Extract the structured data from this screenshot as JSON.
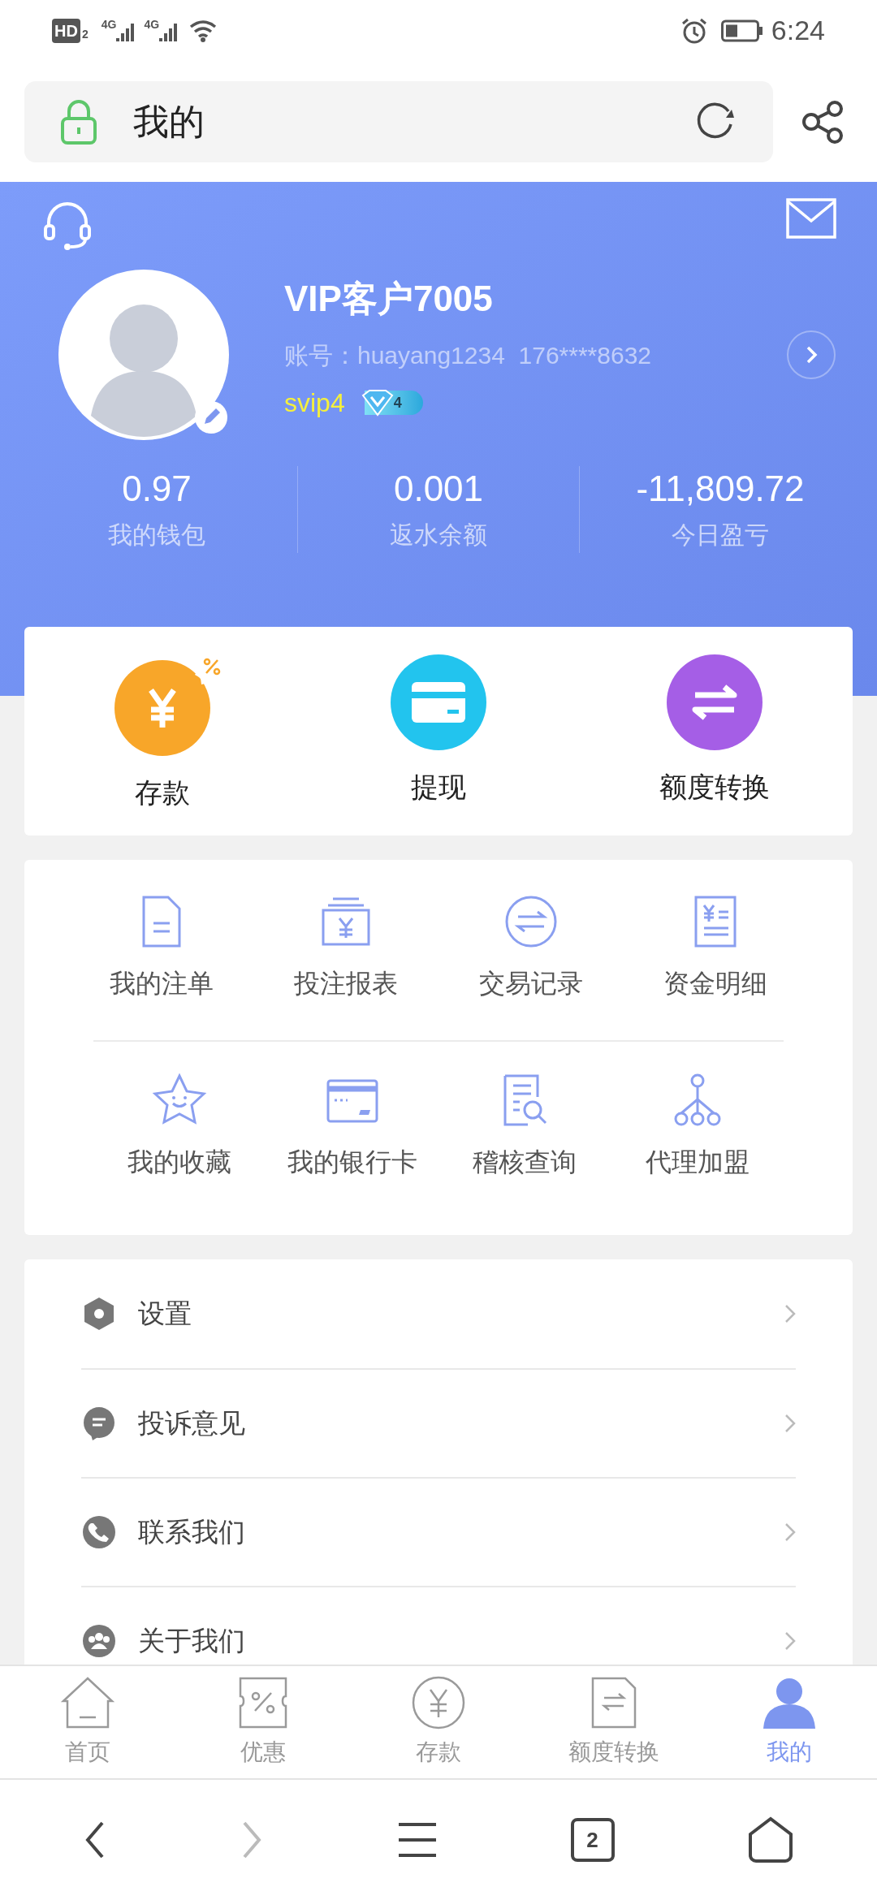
{
  "status_bar": {
    "hd": "HD",
    "sim": "2",
    "network_1": "4G",
    "network_2": "4G",
    "time": "6:24"
  },
  "address_bar": {
    "title": "我的"
  },
  "profile": {
    "name": "VIP客户7005",
    "account": "账号：huayang1234  176****8632",
    "vip_level": "svip4",
    "badge_number": "4"
  },
  "stats": [
    {
      "value": "0.97",
      "label": "我的钱包"
    },
    {
      "value": "0.001",
      "label": "返水余额"
    },
    {
      "value": "-11,809.72",
      "label": "今日盈亏"
    }
  ],
  "actions": [
    {
      "kind": "deposit",
      "label": "存款"
    },
    {
      "kind": "withdraw",
      "label": "提现"
    },
    {
      "kind": "transfer",
      "label": "额度转换"
    }
  ],
  "shortcuts": [
    {
      "kind": "doc",
      "label": "我的注单"
    },
    {
      "kind": "report",
      "label": "投注报表"
    },
    {
      "kind": "exchange",
      "label": "交易记录"
    },
    {
      "kind": "ledger",
      "label": "资金明细"
    },
    {
      "kind": "star",
      "label": "我的收藏"
    },
    {
      "kind": "card",
      "label": "我的银行卡"
    },
    {
      "kind": "audit",
      "label": "稽核查询"
    },
    {
      "kind": "agent",
      "label": "代理加盟"
    }
  ],
  "menu": [
    {
      "kind": "settings",
      "label": "设置"
    },
    {
      "kind": "feedback",
      "label": "投诉意见"
    },
    {
      "kind": "phone",
      "label": "联系我们"
    },
    {
      "kind": "about",
      "label": "关于我们"
    }
  ],
  "tab_bar": [
    {
      "kind": "home",
      "label": "首页",
      "selected": false
    },
    {
      "kind": "promo",
      "label": "优惠",
      "selected": false
    },
    {
      "kind": "deposit",
      "label": "存款",
      "selected": false
    },
    {
      "kind": "transfer",
      "label": "额度转换",
      "selected": false
    },
    {
      "kind": "me",
      "label": "我的",
      "selected": true
    }
  ],
  "browser_nav": {
    "tab_count": "2"
  }
}
